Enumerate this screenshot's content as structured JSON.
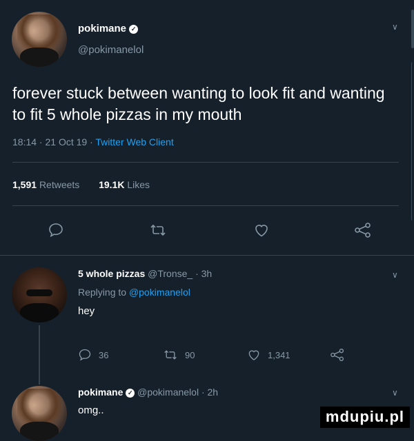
{
  "main_tweet": {
    "display_name": "pokimane",
    "handle": "@pokimanelol",
    "text": "forever stuck between wanting to look fit and wanting to fit 5 whole pizzas in my mouth",
    "time": "18:14 · 21 Oct 19 ·",
    "client": "Twitter Web Client",
    "retweets_count": "1,591",
    "retweets_label": "Retweets",
    "likes_count": "19.1K",
    "likes_label": "Likes"
  },
  "reply": {
    "display_name": "5 whole pizzas",
    "meta": "@Tronse_ · 3h",
    "replying_prefix": "Replying to",
    "replying_handle": "@pokimanelol",
    "text": "hey",
    "comments": "36",
    "retweets": "90",
    "likes": "1,341"
  },
  "reply2": {
    "display_name": "pokimane",
    "meta": "@pokimanelol · 2h",
    "text": "omg.."
  },
  "watermark": "mdupiu.pl",
  "colors": {
    "background": "#15202b",
    "muted": "#8899a6",
    "link": "#1da1f2",
    "divider": "#38444d"
  },
  "icons": [
    "comment-icon",
    "retweet-icon",
    "like-icon",
    "share-icon",
    "chevron-down-icon",
    "verified-badge-icon"
  ]
}
